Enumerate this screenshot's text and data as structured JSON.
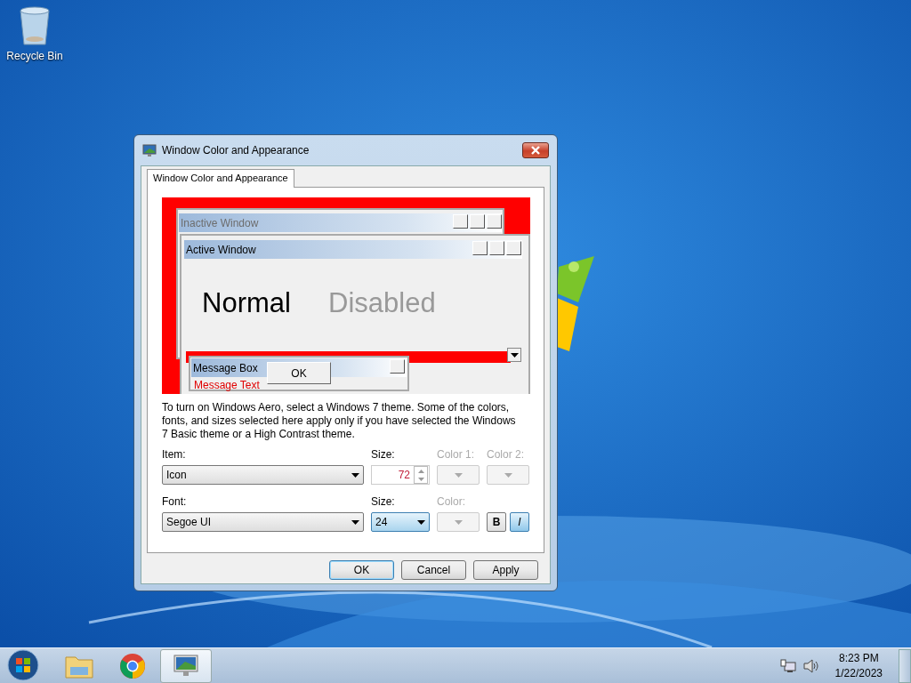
{
  "desktop_icons": [
    {
      "label": "Recycle Bin"
    }
  ],
  "dialog": {
    "title": "Window Color and Appearance",
    "tabs": [
      {
        "label": "Window Color and Appearance",
        "selected": true
      }
    ],
    "preview": {
      "inactive_title": "Inactive Window",
      "active_title": "Active Window",
      "normal_text": "Normal",
      "disabled_text": "Disabled",
      "message_box_title": "Message Box",
      "message_text": "Message Text",
      "ok_label": "OK"
    },
    "description": "To turn on Windows Aero, select a Windows 7 theme.  Some of the colors, fonts, and sizes selected here apply only if you have selected the Windows 7 Basic theme or a High Contrast theme.",
    "item": {
      "label": "Item:",
      "value": "Icon"
    },
    "item_size": {
      "label": "Size:",
      "value": "72"
    },
    "color_1": {
      "label": "Color 1:",
      "disabled": true
    },
    "color_2": {
      "label": "Color 2:",
      "disabled": true
    },
    "font": {
      "label": "Font:",
      "value": "Segoe UI"
    },
    "font_size": {
      "label": "Size:",
      "value": "24",
      "focused": true
    },
    "font_color": {
      "label": "Color:",
      "disabled": true
    },
    "bold": {
      "label": "B",
      "pressed": false
    },
    "italic": {
      "label": "I",
      "pressed": true
    },
    "buttons": [
      {
        "label": "OK",
        "default": true
      },
      {
        "label": "Cancel",
        "default": false
      },
      {
        "label": "Apply",
        "default": false
      }
    ]
  },
  "taskbar": {
    "apps": [
      {
        "kind": "explorer",
        "active": false
      },
      {
        "kind": "chrome",
        "active": false
      },
      {
        "kind": "display",
        "active": true
      }
    ],
    "time": "8:23 PM",
    "date": "1/22/2023"
  }
}
